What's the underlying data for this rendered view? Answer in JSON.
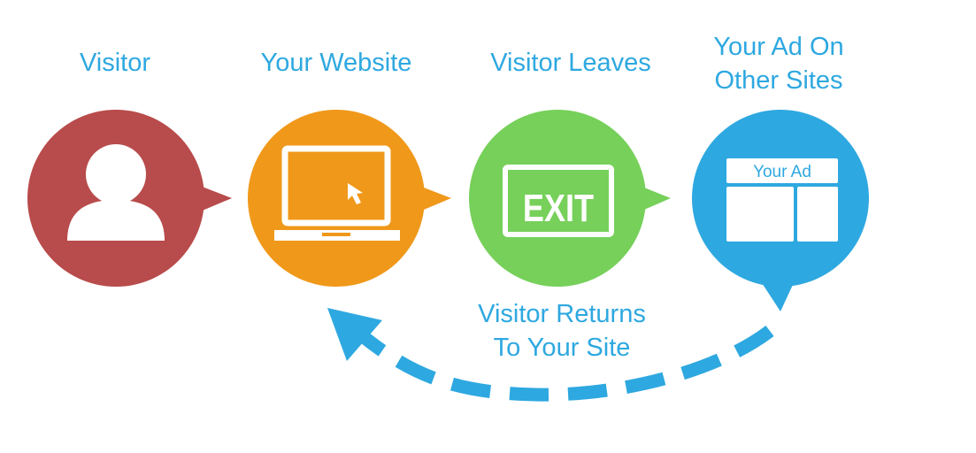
{
  "steps": [
    {
      "label": "Visitor",
      "color": "#b84b4b",
      "icon": "user-icon"
    },
    {
      "label": "Your Website",
      "color": "#f0981a",
      "icon": "laptop-icon"
    },
    {
      "label": "Visitor Leaves",
      "color": "#76d05a",
      "icon": "exit-sign-icon",
      "sign_text": "EXIT"
    },
    {
      "label": "Your Ad On\nOther Sites",
      "color": "#2ea8e0",
      "icon": "ad-layout-icon",
      "ad_text": "Your Ad"
    }
  ],
  "return_label": "Visitor Returns\nTo Your Site",
  "label_color": "#2ea8e0"
}
